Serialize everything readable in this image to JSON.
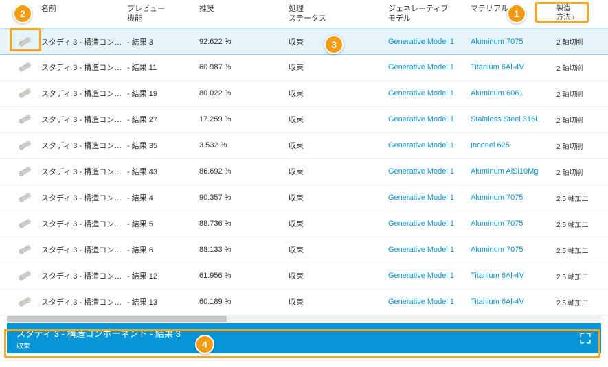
{
  "columns": {
    "name": "名前",
    "preview": "プレビュー\n機能",
    "recommend": "推奨",
    "status": "処理\nステータス",
    "model": "ジェネレーティブ\nモデル",
    "material": "マテリアル",
    "method": "製造\n方法"
  },
  "sort_indicator": "↓",
  "rows": [
    {
      "name": "スタディ 3 - 構造コンポ...",
      "preview": "- 結果 3",
      "recommend": "92.622 %",
      "status": "収束",
      "model": "Generative Model 1",
      "material": "Aluminum 7075",
      "method": "2 軸切削",
      "selected": true
    },
    {
      "name": "スタディ 3 - 構造コンポ...",
      "preview": "- 結果 11",
      "recommend": "60.987 %",
      "status": "収束",
      "model": "Generative Model 1",
      "material": "Titanium 6Al-4V",
      "method": "2 軸切削",
      "selected": false
    },
    {
      "name": "スタディ 3 - 構造コンポ...",
      "preview": "- 結果 19",
      "recommend": "80.022 %",
      "status": "収束",
      "model": "Generative Model 1",
      "material": "Aluminum 6061",
      "method": "2 軸切削",
      "selected": false
    },
    {
      "name": "スタディ 3 - 構造コンポ...",
      "preview": "- 結果 27",
      "recommend": "17.259 %",
      "status": "収束",
      "model": "Generative Model 1",
      "material": "Stainless Steel 316L",
      "method": "2 軸切削",
      "selected": false
    },
    {
      "name": "スタディ 3 - 構造コンポ...",
      "preview": "- 結果 35",
      "recommend": "3.532 %",
      "status": "収束",
      "model": "Generative Model 1",
      "material": "Inconel 625",
      "method": "2 軸切削",
      "selected": false
    },
    {
      "name": "スタディ 3 - 構造コンポ...",
      "preview": "- 結果 43",
      "recommend": "86.692 %",
      "status": "収束",
      "model": "Generative Model 1",
      "material": "Aluminum AlSi10Mg",
      "method": "2 軸切削",
      "selected": false
    },
    {
      "name": "スタディ 3 - 構造コンポ...",
      "preview": "- 結果 4",
      "recommend": "90.357 %",
      "status": "収束",
      "model": "Generative Model 1",
      "material": "Aluminum 7075",
      "method": "2.5 軸加工",
      "selected": false
    },
    {
      "name": "スタディ 3 - 構造コンポ...",
      "preview": "- 結果 5",
      "recommend": "88.736 %",
      "status": "収束",
      "model": "Generative Model 1",
      "material": "Aluminum 7075",
      "method": "2.5 軸加工",
      "selected": false
    },
    {
      "name": "スタディ 3 - 構造コンポ...",
      "preview": "- 結果 6",
      "recommend": "88.133 %",
      "status": "収束",
      "model": "Generative Model 1",
      "material": "Aluminum 7075",
      "method": "2.5 軸加工",
      "selected": false
    },
    {
      "name": "スタディ 3 - 構造コンポ...",
      "preview": "- 結果 12",
      "recommend": "61.956 %",
      "status": "収束",
      "model": "Generative Model 1",
      "material": "Titanium 6Al-4V",
      "method": "2.5 軸加工",
      "selected": false
    },
    {
      "name": "スタディ 3 - 構造コンポ...",
      "preview": "- 結果 13",
      "recommend": "60.189 %",
      "status": "収束",
      "model": "Generative Model 1",
      "material": "Titanium 6Al-4V",
      "method": "2.5 軸加工",
      "selected": false
    }
  ],
  "detail": {
    "title": "スタディ 3 - 構造コンポーネント - 結果 3",
    "sub": "収束"
  },
  "callouts": {
    "c1": "1",
    "c2": "2",
    "c3": "3",
    "c4": "4"
  }
}
